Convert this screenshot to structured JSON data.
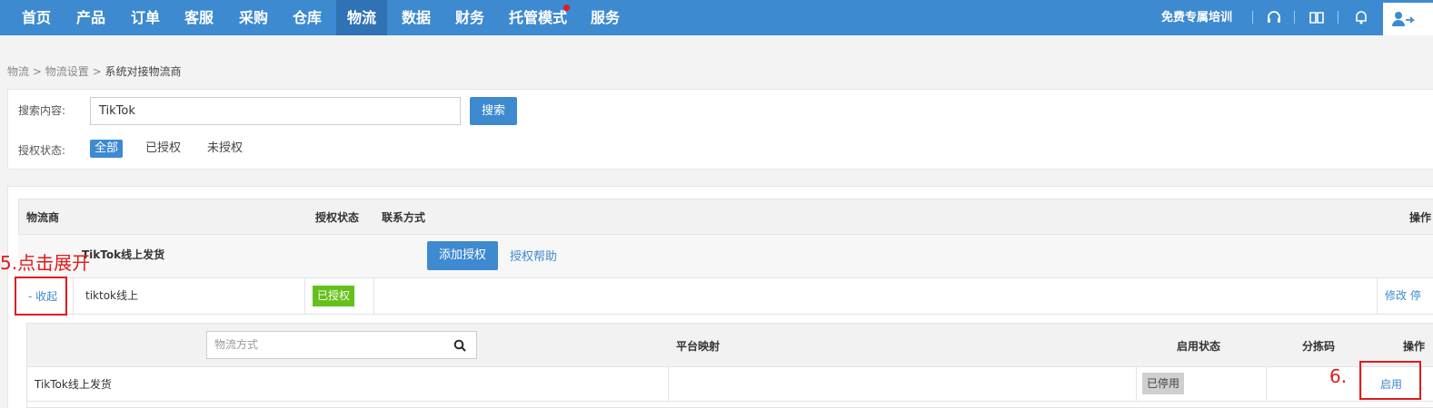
{
  "nav": {
    "items": [
      {
        "label": "首页"
      },
      {
        "label": "产品"
      },
      {
        "label": "订单"
      },
      {
        "label": "客服"
      },
      {
        "label": "采购"
      },
      {
        "label": "仓库"
      },
      {
        "label": "物流"
      },
      {
        "label": "数据"
      },
      {
        "label": "财务"
      },
      {
        "label": "托管模式"
      },
      {
        "label": "服务"
      }
    ],
    "active": "物流",
    "training": "免费专属培训",
    "icons": [
      "headset-icon",
      "book-icon",
      "bell-icon",
      "user-icon"
    ]
  },
  "breadcrumb": {
    "level1": "物流",
    "level2": "物流设置",
    "current": "系统对接物流商",
    "sep": ">"
  },
  "search": {
    "label": "搜索内容:",
    "value": "TikTok",
    "button": "搜索",
    "auth_label": "授权状态:",
    "options": [
      "全部",
      "已授权",
      "未授权"
    ],
    "selected": "全部"
  },
  "table": {
    "headers": {
      "carrier": "物流商",
      "auth_status": "授权状态",
      "contact": "联系方式",
      "ops": "操作"
    },
    "group": {
      "name": "TikTok线上发货",
      "add_auth": "添加授权",
      "help": "授权帮助"
    },
    "row": {
      "toggle": "- 收起",
      "name": "tiktok线上",
      "status": "已授权",
      "ops": "修改 停"
    },
    "sub": {
      "search_placeholder": "物流方式",
      "headers": {
        "mapping": "平台映射",
        "enable_status": "启用状态",
        "sort_code": "分拣码",
        "ops": "操作"
      },
      "rows": [
        {
          "name": "TikTok线上发货",
          "status": "已停用",
          "action": "启用"
        }
      ]
    }
  },
  "annotations": {
    "step5": "5.点击展开",
    "step6": "6."
  },
  "colors": {
    "nav_bg": "#3d8ad0",
    "nav_active": "#2f73b4",
    "link": "#3d8ad0",
    "badge_authorized": "#64c01a",
    "badge_disabled": "#cfcfcf",
    "annotation": "#e01b1b"
  }
}
